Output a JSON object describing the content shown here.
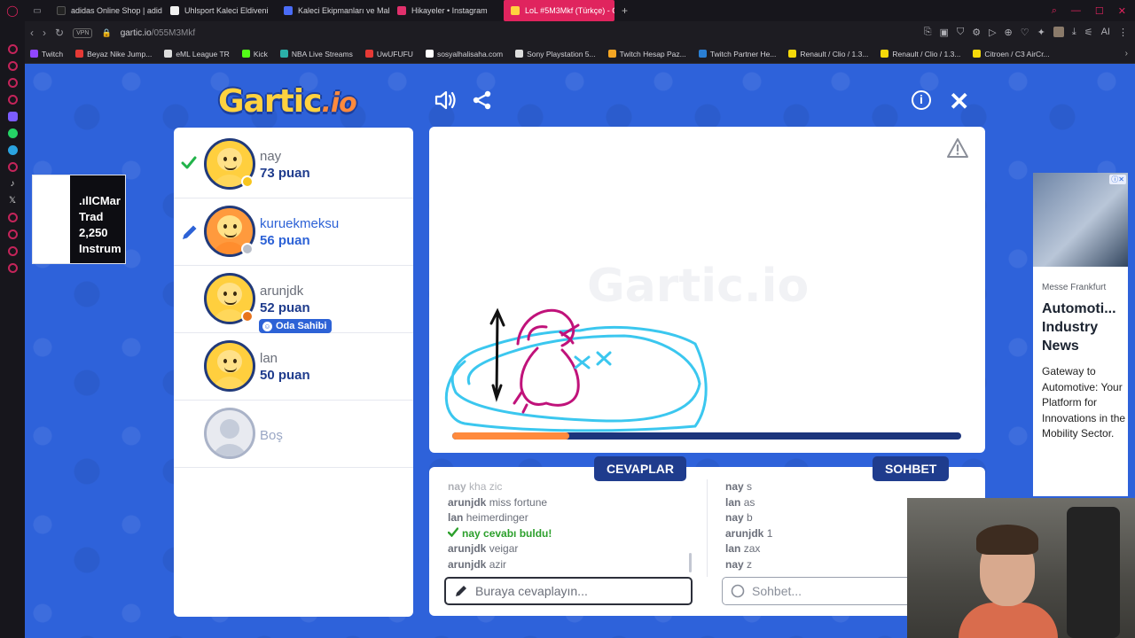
{
  "browser": {
    "tabs": [
      {
        "title": "adidas Online Shop | adid",
        "color": "#222222"
      },
      {
        "title": "Uhlsport Kaleci Eldiveni",
        "color": "#f2f2f2"
      },
      {
        "title": "Kaleci Ekipmanları ve Mal",
        "color": "#4a6cf7"
      },
      {
        "title": "Hikayeler • Instagram",
        "color": "#e1306c"
      },
      {
        "title": "LoL #5M3Mkf (Türkçe) - G",
        "color": "#ffd23f",
        "active": true
      }
    ],
    "url_host": "gartic.io",
    "url_path": "/055M3Mkf",
    "vpn_label": "VPN",
    "ai_label": "AI",
    "bookmarks": [
      {
        "title": "Twitch",
        "color": "#9146ff"
      },
      {
        "title": "Beyaz Nike Jump...",
        "color": "#e53935"
      },
      {
        "title": "eML League TR",
        "color": "#dddddd"
      },
      {
        "title": "Kick",
        "color": "#53fc18"
      },
      {
        "title": "NBA Live Streams",
        "color": "#2bb0a8"
      },
      {
        "title": "UwUFUFU",
        "color": "#e53935"
      },
      {
        "title": "sosyalhalisaha.com",
        "color": "#ffffff"
      },
      {
        "title": "Sony Playstation 5...",
        "color": "#dddddd"
      },
      {
        "title": "Twitch Hesap Paz...",
        "color": "#f5a623"
      },
      {
        "title": "Twitch Partner He...",
        "color": "#2a7fd4"
      },
      {
        "title": "Renault / Clio / 1.3...",
        "color": "#f5d90a"
      },
      {
        "title": "Renault / Clio / 1.3...",
        "color": "#f5d90a"
      },
      {
        "title": "Citroen / C3 AirCr...",
        "color": "#f5d90a"
      }
    ]
  },
  "game": {
    "logo_main": "Gartic",
    "logo_suffix": ".io",
    "owner_badge": "Oda Sahibi",
    "players": [
      {
        "name": "nay",
        "score": "73 puan",
        "status": "guessed",
        "avatar": "yellow",
        "dot_color": "#f7c51e"
      },
      {
        "name": "kuruekmeksu",
        "score": "56 puan",
        "status": "drawing",
        "avatar": "orange",
        "dot_color": "#b9bec9"
      },
      {
        "name": "arunjdk",
        "score": "52 puan",
        "status": "owner",
        "avatar": "yellow",
        "dot_color": "#e8741d"
      },
      {
        "name": "lan",
        "score": "50 puan",
        "status": "none",
        "avatar": "yellow",
        "dot_color": ""
      },
      {
        "name": "Boş",
        "score": "",
        "status": "empty",
        "avatar": "empty",
        "dot_color": ""
      }
    ],
    "canvas_watermark": "Gartic.io",
    "timer_progress": 0.23,
    "answers_title": "CEVAPLAR",
    "chat_title": "SOHBET",
    "answers": [
      {
        "user": "nay",
        "text": "kha zic",
        "faded": true
      },
      {
        "user": "arunjdk",
        "text": "miss fortune"
      },
      {
        "user": "lan",
        "text": "heimerdinger"
      },
      {
        "user": "nay",
        "text": "cevabı buldu!",
        "correct": true
      },
      {
        "user": "arunjdk",
        "text": "veigar"
      },
      {
        "user": "arunjdk",
        "text": "azir"
      }
    ],
    "chat": [
      {
        "user": "nay",
        "text": "s"
      },
      {
        "user": "lan",
        "text": "as"
      },
      {
        "user": "nay",
        "text": "b"
      },
      {
        "user": "arunjdk",
        "text": "1"
      },
      {
        "user": "lan",
        "text": "zax"
      },
      {
        "user": "nay",
        "text": "z"
      }
    ],
    "answer_placeholder": "Buraya cevaplayın...",
    "chat_placeholder": "Sohbet..."
  },
  "ads": {
    "left_text": ".ılICMar Trad 2,250 Instrum",
    "right_source": "Messe Frankfurt",
    "right_headline": "Automoti... Industry News",
    "right_body": "Gateway to Automotive: Your Platform for Innovations in the Mobility Sector."
  }
}
